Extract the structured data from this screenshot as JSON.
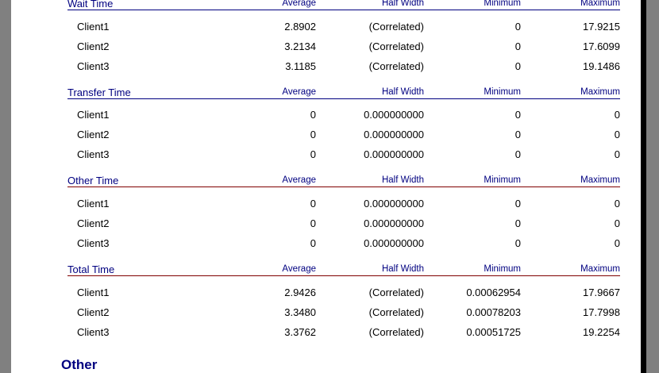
{
  "columns": {
    "average": "Average",
    "half_width": "Half Width",
    "minimum": "Minimum",
    "maximum": "Maximum"
  },
  "sections": [
    {
      "title": "Wait Time",
      "rows": [
        {
          "name": "Client1",
          "average": "2.8902",
          "half_width": "(Correlated)",
          "minimum": "0",
          "maximum": "17.9215"
        },
        {
          "name": "Client2",
          "average": "3.2134",
          "half_width": "(Correlated)",
          "minimum": "0",
          "maximum": "17.6099"
        },
        {
          "name": "Client3",
          "average": "3.1185",
          "half_width": "(Correlated)",
          "minimum": "0",
          "maximum": "19.1486"
        }
      ]
    },
    {
      "title": "Transfer Time",
      "rows": [
        {
          "name": "Client1",
          "average": "0",
          "half_width": "0.000000000",
          "minimum": "0",
          "maximum": "0"
        },
        {
          "name": "Client2",
          "average": "0",
          "half_width": "0.000000000",
          "minimum": "0",
          "maximum": "0"
        },
        {
          "name": "Client3",
          "average": "0",
          "half_width": "0.000000000",
          "minimum": "0",
          "maximum": "0"
        }
      ]
    },
    {
      "title": "Other Time",
      "rows": [
        {
          "name": "Client1",
          "average": "0",
          "half_width": "0.000000000",
          "minimum": "0",
          "maximum": "0"
        },
        {
          "name": "Client2",
          "average": "0",
          "half_width": "0.000000000",
          "minimum": "0",
          "maximum": "0"
        },
        {
          "name": "Client3",
          "average": "0",
          "half_width": "0.000000000",
          "minimum": "0",
          "maximum": "0"
        }
      ]
    },
    {
      "title": "Total Time",
      "rows": [
        {
          "name": "Client1",
          "average": "2.9426",
          "half_width": "(Correlated)",
          "minimum": "0.00062954",
          "maximum": "17.9667"
        },
        {
          "name": "Client2",
          "average": "3.3480",
          "half_width": "(Correlated)",
          "minimum": "0.00078203",
          "maximum": "17.7998"
        },
        {
          "name": "Client3",
          "average": "3.3762",
          "half_width": "(Correlated)",
          "minimum": "0.00051725",
          "maximum": "19.2254"
        }
      ]
    }
  ],
  "next_heading": "Other",
  "colors": {
    "heading_blue": "#000080",
    "rule_red": "#800000",
    "background_gray": "#808080"
  }
}
